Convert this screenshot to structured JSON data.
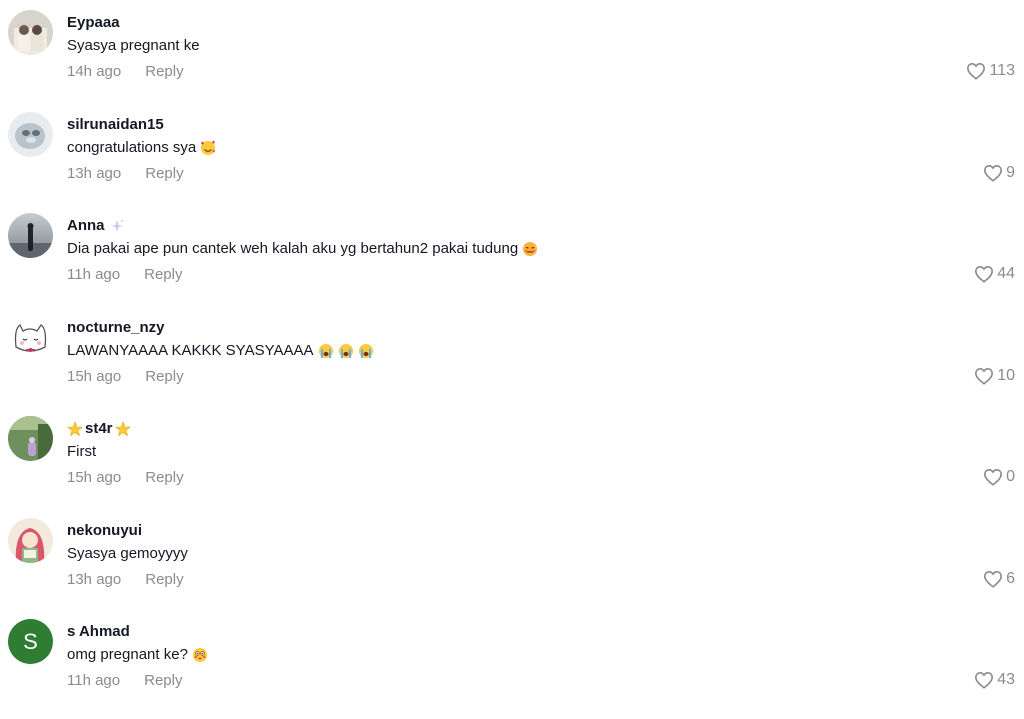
{
  "comments": [
    {
      "username": "Eypaaa",
      "text": "Syasya pregnant ke",
      "time": "14h ago",
      "reply": "Reply",
      "likes": "113"
    },
    {
      "username": "silrunaidan15",
      "text": "congratulations sya",
      "time": "13h ago",
      "reply": "Reply",
      "likes": "9"
    },
    {
      "username": "Anna",
      "text": "Dia pakai ape pun cantek weh kalah aku yg bertahun2 pakai tudung",
      "time": "11h ago",
      "reply": "Reply",
      "likes": "44"
    },
    {
      "username": "nocturne_nzy",
      "text": "LAWANYAAAA KAKKK SYASYAAAA",
      "time": "15h ago",
      "reply": "Reply",
      "likes": "10"
    },
    {
      "username": "st4r",
      "text": "First",
      "time": "15h ago",
      "reply": "Reply",
      "likes": "0"
    },
    {
      "username": "nekonuyui",
      "text": "Syasya gemoyyyy",
      "time": "13h ago",
      "reply": "Reply",
      "likes": "6"
    },
    {
      "username": "s Ahmad",
      "avatar_letter": "S",
      "avatar_color": "#2e7d32",
      "text": "omg pregnant ke?",
      "time": "11h ago",
      "reply": "Reply",
      "likes": "43"
    }
  ],
  "colors": {
    "secondary_text": "#8a8b91",
    "primary_text": "#161823"
  }
}
